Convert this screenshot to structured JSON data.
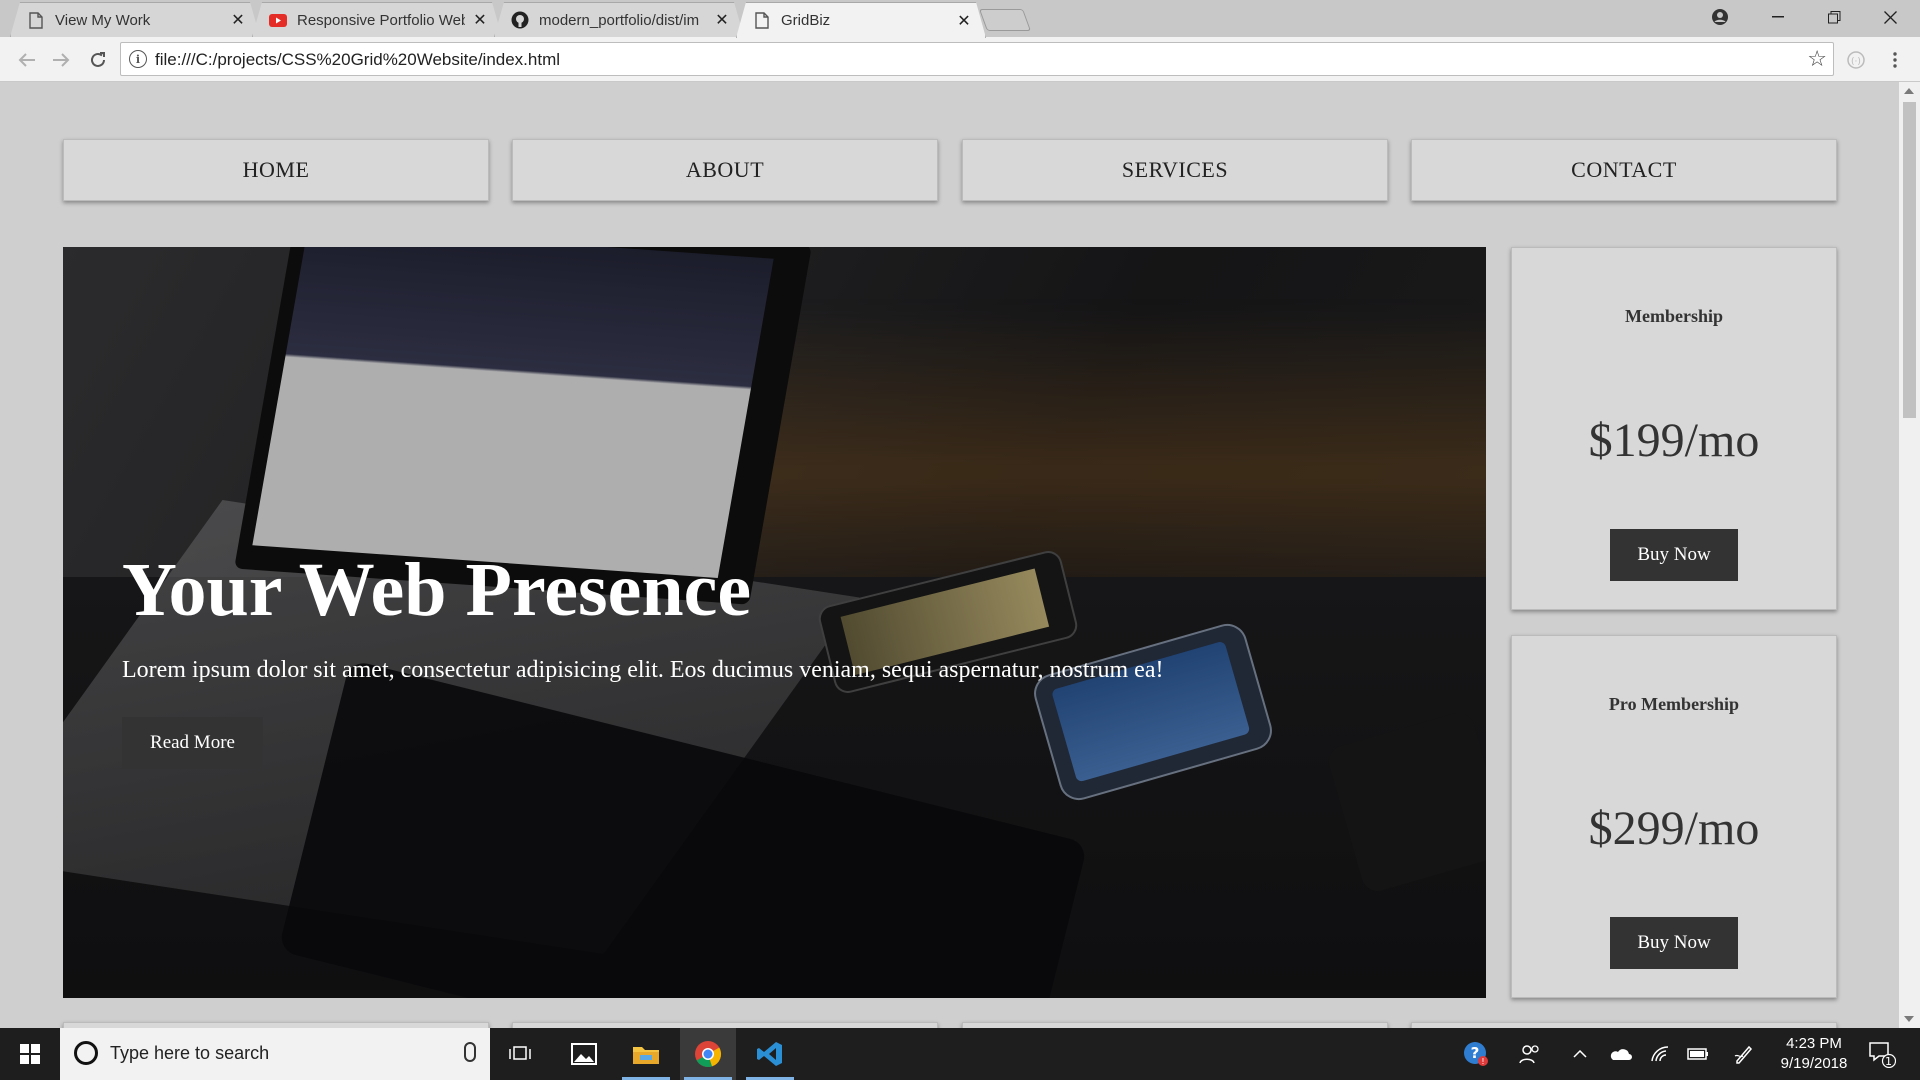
{
  "browser": {
    "tabs": [
      {
        "label": "View My Work",
        "icon": "page-icon"
      },
      {
        "label": "Responsive Portfolio Web",
        "icon": "youtube-icon"
      },
      {
        "label": "modern_portfolio/dist/im",
        "icon": "github-icon"
      },
      {
        "label": "GridBiz",
        "icon": "page-icon"
      }
    ],
    "active_tab": 3,
    "url": "file:///C:/projects/CSS%20Grid%20Website/index.html"
  },
  "page": {
    "nav": [
      "HOME",
      "ABOUT",
      "SERVICES",
      "CONTACT"
    ],
    "hero": {
      "title": "Your Web Presence",
      "text": "Lorem ipsum dolor sit amet, consectetur adipisicing elit. Eos ducimus veniam, sequi aspernatur, nostrum ea!",
      "button": "Read More"
    },
    "cards": [
      {
        "title": "Membership",
        "price": "$199/mo",
        "button": "Buy Now"
      },
      {
        "title": "Pro Membership",
        "price": "$299/mo",
        "button": "Buy Now"
      }
    ]
  },
  "taskbar": {
    "search_placeholder": "Type here to search",
    "time": "4:23 PM",
    "date": "9/19/2018",
    "notification_count": "1"
  },
  "colors": {
    "page_bg": "#cfcfcf",
    "box_bg": "#d8d8d8",
    "button_bg": "#333333",
    "taskbar_bg": "#1e1e1e"
  }
}
